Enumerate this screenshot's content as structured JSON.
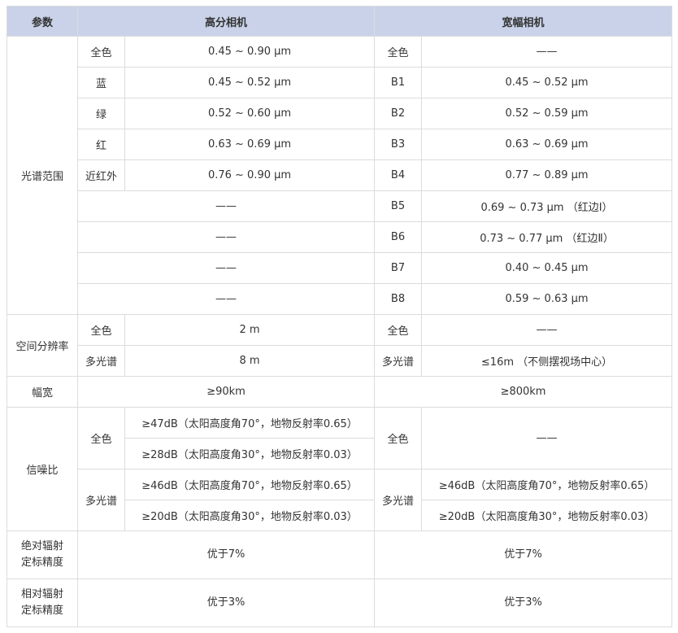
{
  "header": {
    "param": "参数",
    "hr": "高分相机",
    "wide": "宽幅相机"
  },
  "spectral": {
    "label": "光谱范围",
    "rows": [
      {
        "hr_band": "全色",
        "hr_val": "0.45 ~ 0.90 μm",
        "w_band": "全色",
        "w_val": "——"
      },
      {
        "hr_band": "蓝",
        "hr_val": "0.45 ~ 0.52 μm",
        "w_band": "B1",
        "w_val": "0.45 ~ 0.52 μm"
      },
      {
        "hr_band": "绿",
        "hr_val": "0.52 ~ 0.60 μm",
        "w_band": "B2",
        "w_val": "0.52 ~ 0.59 μm"
      },
      {
        "hr_band": "红",
        "hr_val": "0.63 ~ 0.69 μm",
        "w_band": "B3",
        "w_val": "0.63 ~ 0.69 μm"
      },
      {
        "hr_band": "近红外",
        "hr_val": "0.76 ~ 0.90 μm",
        "w_band": "B4",
        "w_val": "0.77 ~ 0.89 μm"
      },
      {
        "hr_merged": "——",
        "w_band": "B5",
        "w_val": "0.69 ~ 0.73 μm （红边Ⅰ）"
      },
      {
        "hr_merged": "——",
        "w_band": "B6",
        "w_val": "0.73 ~ 0.77 μm （红边Ⅱ）"
      },
      {
        "hr_merged": "——",
        "w_band": "B7",
        "w_val": "0.40 ~ 0.45 μm"
      },
      {
        "hr_merged": "——",
        "w_band": "B8",
        "w_val": "0.59 ~ 0.63 μm"
      }
    ]
  },
  "resolution": {
    "label": "空间分辨率",
    "rows": [
      {
        "hr_band": "全色",
        "hr_val": "2 m",
        "w_band": "全色",
        "w_val": "——"
      },
      {
        "hr_band": "多光谱",
        "hr_val": "8 m",
        "w_band": "多光谱",
        "w_val": "≤16m （不侧摆视场中心）"
      }
    ]
  },
  "swath": {
    "label": "幅宽",
    "hr": "≥90km",
    "wide": "≥800km"
  },
  "snr": {
    "label": "信噪比",
    "pan_label": "全色",
    "ms_label": "多光谱",
    "hr_pan_1": "≥47dB（太阳高度角70°，地物反射率0.65）",
    "hr_pan_2": "≥28dB（太阳高度角30°，地物反射率0.03）",
    "w_pan": "——",
    "hr_ms_1": "≥46dB（太阳高度角70°，地物反射率0.65）",
    "hr_ms_2": "≥20dB（太阳高度角30°，地物反射率0.03）",
    "w_ms_1": "≥46dB（太阳高度角70°，地物反射率0.65）",
    "w_ms_2": "≥20dB（太阳高度角30°，地物反射率0.03）"
  },
  "abs_cal": {
    "label_1": "绝对辐射",
    "label_2": "定标精度",
    "hr": "优于7%",
    "wide": "优于7%"
  },
  "rel_cal": {
    "label_1": "相对辐射",
    "label_2": "定标精度",
    "hr": "优于3%",
    "wide": "优于3%"
  }
}
